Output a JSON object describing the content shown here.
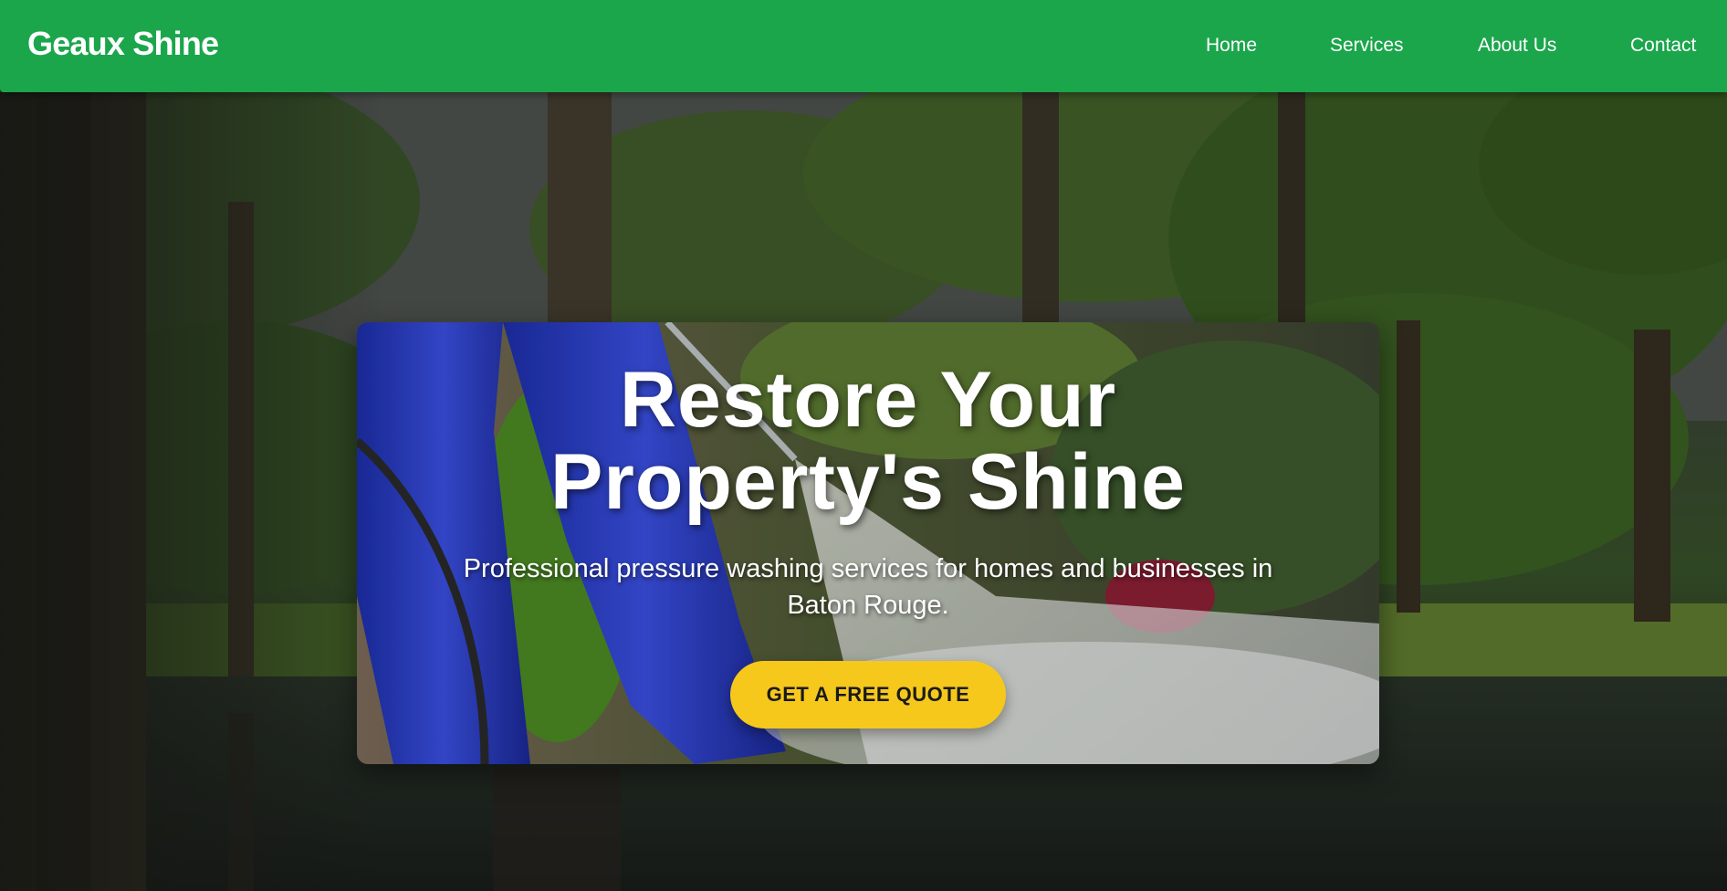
{
  "header": {
    "brand": "Geaux Shine",
    "nav": [
      "Home",
      "Services",
      "About Us",
      "Contact"
    ]
  },
  "hero": {
    "title_line1": "Restore Your",
    "title_line2": "Property's Shine",
    "subtitle_line1": "Professional pressure washing services for homes and businesses in",
    "subtitle_line2": "Baton Rouge.",
    "cta_label": "GET A FREE QUOTE"
  },
  "colors": {
    "header_bg": "#1ba64c",
    "cta_bg": "#f6c81c",
    "text": "#ffffff"
  }
}
